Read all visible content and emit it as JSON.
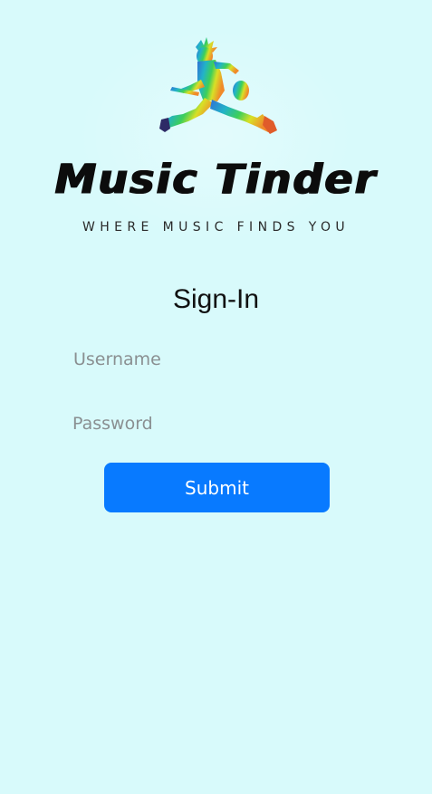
{
  "brand": {
    "name": "Music Tinder",
    "tagline": "WHERE MUSIC FINDS YOU",
    "logo_icon": "guitarist-jumping-icon"
  },
  "form": {
    "title": "Sign-In",
    "username_placeholder": "Username",
    "password_placeholder": "Password",
    "submit_label": "Submit"
  },
  "colors": {
    "background": "#d8fafb",
    "accent": "#087aff",
    "button_text": "#ffffff"
  }
}
